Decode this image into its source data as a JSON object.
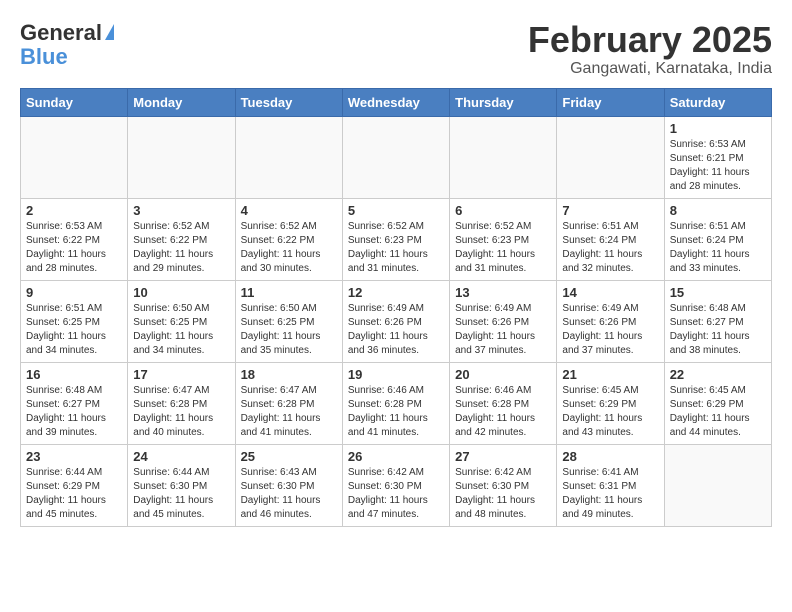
{
  "header": {
    "logo_general": "General",
    "logo_blue": "Blue",
    "month_title": "February 2025",
    "subtitle": "Gangawati, Karnataka, India"
  },
  "weekdays": [
    "Sunday",
    "Monday",
    "Tuesday",
    "Wednesday",
    "Thursday",
    "Friday",
    "Saturday"
  ],
  "weeks": [
    [
      {
        "day": "",
        "info": ""
      },
      {
        "day": "",
        "info": ""
      },
      {
        "day": "",
        "info": ""
      },
      {
        "day": "",
        "info": ""
      },
      {
        "day": "",
        "info": ""
      },
      {
        "day": "",
        "info": ""
      },
      {
        "day": "1",
        "info": "Sunrise: 6:53 AM\nSunset: 6:21 PM\nDaylight: 11 hours\nand 28 minutes."
      }
    ],
    [
      {
        "day": "2",
        "info": "Sunrise: 6:53 AM\nSunset: 6:22 PM\nDaylight: 11 hours\nand 28 minutes."
      },
      {
        "day": "3",
        "info": "Sunrise: 6:52 AM\nSunset: 6:22 PM\nDaylight: 11 hours\nand 29 minutes."
      },
      {
        "day": "4",
        "info": "Sunrise: 6:52 AM\nSunset: 6:22 PM\nDaylight: 11 hours\nand 30 minutes."
      },
      {
        "day": "5",
        "info": "Sunrise: 6:52 AM\nSunset: 6:23 PM\nDaylight: 11 hours\nand 31 minutes."
      },
      {
        "day": "6",
        "info": "Sunrise: 6:52 AM\nSunset: 6:23 PM\nDaylight: 11 hours\nand 31 minutes."
      },
      {
        "day": "7",
        "info": "Sunrise: 6:51 AM\nSunset: 6:24 PM\nDaylight: 11 hours\nand 32 minutes."
      },
      {
        "day": "8",
        "info": "Sunrise: 6:51 AM\nSunset: 6:24 PM\nDaylight: 11 hours\nand 33 minutes."
      }
    ],
    [
      {
        "day": "9",
        "info": "Sunrise: 6:51 AM\nSunset: 6:25 PM\nDaylight: 11 hours\nand 34 minutes."
      },
      {
        "day": "10",
        "info": "Sunrise: 6:50 AM\nSunset: 6:25 PM\nDaylight: 11 hours\nand 34 minutes."
      },
      {
        "day": "11",
        "info": "Sunrise: 6:50 AM\nSunset: 6:25 PM\nDaylight: 11 hours\nand 35 minutes."
      },
      {
        "day": "12",
        "info": "Sunrise: 6:49 AM\nSunset: 6:26 PM\nDaylight: 11 hours\nand 36 minutes."
      },
      {
        "day": "13",
        "info": "Sunrise: 6:49 AM\nSunset: 6:26 PM\nDaylight: 11 hours\nand 37 minutes."
      },
      {
        "day": "14",
        "info": "Sunrise: 6:49 AM\nSunset: 6:26 PM\nDaylight: 11 hours\nand 37 minutes."
      },
      {
        "day": "15",
        "info": "Sunrise: 6:48 AM\nSunset: 6:27 PM\nDaylight: 11 hours\nand 38 minutes."
      }
    ],
    [
      {
        "day": "16",
        "info": "Sunrise: 6:48 AM\nSunset: 6:27 PM\nDaylight: 11 hours\nand 39 minutes."
      },
      {
        "day": "17",
        "info": "Sunrise: 6:47 AM\nSunset: 6:28 PM\nDaylight: 11 hours\nand 40 minutes."
      },
      {
        "day": "18",
        "info": "Sunrise: 6:47 AM\nSunset: 6:28 PM\nDaylight: 11 hours\nand 41 minutes."
      },
      {
        "day": "19",
        "info": "Sunrise: 6:46 AM\nSunset: 6:28 PM\nDaylight: 11 hours\nand 41 minutes."
      },
      {
        "day": "20",
        "info": "Sunrise: 6:46 AM\nSunset: 6:28 PM\nDaylight: 11 hours\nand 42 minutes."
      },
      {
        "day": "21",
        "info": "Sunrise: 6:45 AM\nSunset: 6:29 PM\nDaylight: 11 hours\nand 43 minutes."
      },
      {
        "day": "22",
        "info": "Sunrise: 6:45 AM\nSunset: 6:29 PM\nDaylight: 11 hours\nand 44 minutes."
      }
    ],
    [
      {
        "day": "23",
        "info": "Sunrise: 6:44 AM\nSunset: 6:29 PM\nDaylight: 11 hours\nand 45 minutes."
      },
      {
        "day": "24",
        "info": "Sunrise: 6:44 AM\nSunset: 6:30 PM\nDaylight: 11 hours\nand 45 minutes."
      },
      {
        "day": "25",
        "info": "Sunrise: 6:43 AM\nSunset: 6:30 PM\nDaylight: 11 hours\nand 46 minutes."
      },
      {
        "day": "26",
        "info": "Sunrise: 6:42 AM\nSunset: 6:30 PM\nDaylight: 11 hours\nand 47 minutes."
      },
      {
        "day": "27",
        "info": "Sunrise: 6:42 AM\nSunset: 6:30 PM\nDaylight: 11 hours\nand 48 minutes."
      },
      {
        "day": "28",
        "info": "Sunrise: 6:41 AM\nSunset: 6:31 PM\nDaylight: 11 hours\nand 49 minutes."
      },
      {
        "day": "",
        "info": ""
      }
    ]
  ]
}
